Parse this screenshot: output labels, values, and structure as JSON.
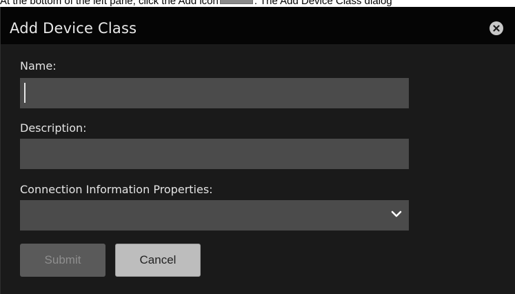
{
  "instruction": {
    "before_icon": "At the bottom of the left pane, click the Add icon",
    "after_icon": ". The Add Device Class dialog"
  },
  "dialog": {
    "title": "Add Device Class",
    "close_icon": "close-icon",
    "fields": {
      "name": {
        "label": "Name:",
        "value": ""
      },
      "description": {
        "label": "Description:",
        "value": ""
      },
      "connection_properties": {
        "label": "Connection Information Properties:",
        "selected": "",
        "icon": "chevron-down-icon"
      }
    },
    "buttons": {
      "submit": "Submit",
      "cancel": "Cancel"
    }
  }
}
